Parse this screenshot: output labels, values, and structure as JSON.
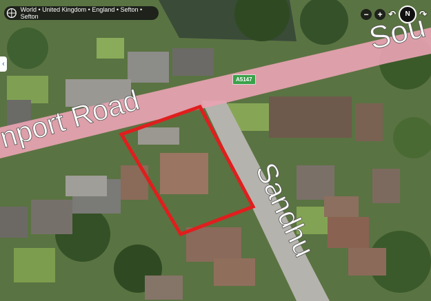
{
  "breadcrumb": {
    "text": "World • United Kingdom • England • Sefton • Sefton"
  },
  "controls": {
    "zoom_out": "−",
    "zoom_in": "+",
    "compass": "N"
  },
  "road_labels": {
    "main_road": "nport Road",
    "main_road_far": "Sou",
    "side_road": "Sandhu",
    "route_shield": "A5147"
  },
  "colors": {
    "road_highlight": "#e8a3b2",
    "site_boundary": "#e01e1e",
    "label": "#ffffff"
  },
  "icons": {
    "breadcrumb": "globe-icon",
    "side_tab": "chevron-left-icon",
    "rotate": "rotate-arrow-icon"
  }
}
